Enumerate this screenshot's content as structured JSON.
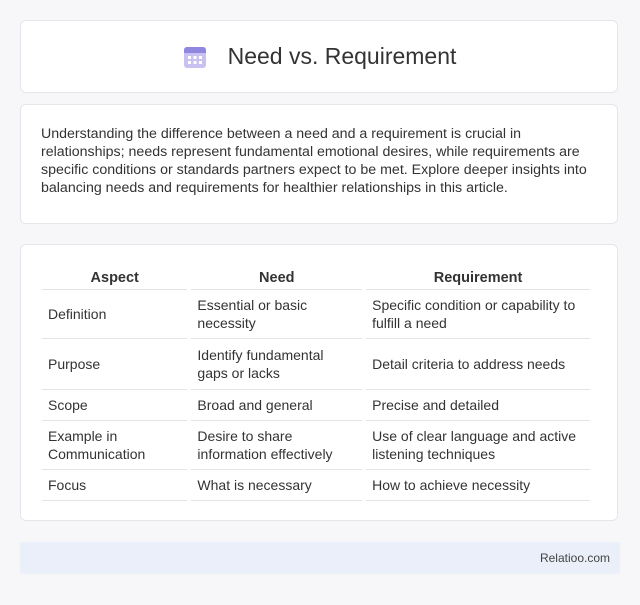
{
  "header": {
    "title": "Need vs. Requirement",
    "icon": "calendar-icon"
  },
  "intro": {
    "text": "Understanding the difference between a need and a requirement is crucial in relationships; needs represent fundamental emotional desires, while requirements are specific conditions or standards partners expect to be met. Explore deeper insights into balancing needs and requirements for healthier relationships in this article."
  },
  "table": {
    "columns": [
      "Aspect",
      "Need",
      "Requirement"
    ],
    "rows": [
      [
        "Definition",
        "Essential or basic necessity",
        "Specific condition or capability to fulfill a need"
      ],
      [
        "Purpose",
        "Identify fundamental gaps or lacks",
        "Detail criteria to address needs"
      ],
      [
        "Scope",
        "Broad and general",
        "Precise and detailed"
      ],
      [
        "Example in Communication",
        "Desire to share information effectively",
        "Use of clear language and active listening techniques"
      ],
      [
        "Focus",
        "What is necessary",
        "How to achieve necessity"
      ]
    ]
  },
  "footer": {
    "brand": "Relatioo.com"
  }
}
